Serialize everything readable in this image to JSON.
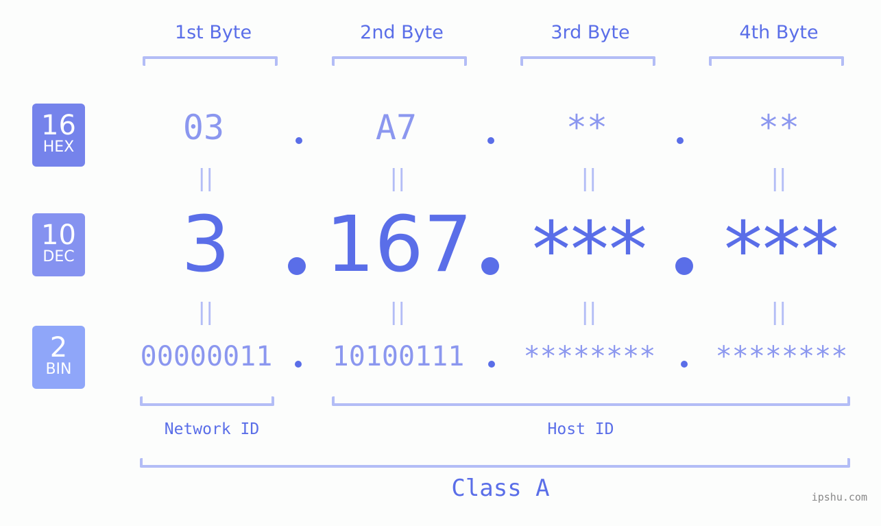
{
  "bytes": {
    "labels": [
      "1st Byte",
      "2nd Byte",
      "3rd Byte",
      "4th Byte"
    ]
  },
  "badges": {
    "hex": {
      "number": "16",
      "label": "HEX",
      "color": "#7583eb"
    },
    "dec": {
      "number": "10",
      "label": "DEC",
      "color": "#8592f0"
    },
    "bin": {
      "number": "2",
      "label": "BIN",
      "color": "#8fa6f9"
    }
  },
  "hex_values": [
    "03",
    "A7",
    "**",
    "**"
  ],
  "dec_values": [
    "3",
    "167",
    "***",
    "***"
  ],
  "bin_values": [
    "00000011",
    "10100111",
    "********",
    "********"
  ],
  "equals_symbol": "||",
  "sections": {
    "network_id": "Network ID",
    "host_id": "Host ID",
    "class": "Class A"
  },
  "footer": {
    "site": "ipshu.com"
  },
  "colors": {
    "primary": "#5a6ee8",
    "light": "#8b97ef",
    "bracket": "#b3bdf6",
    "background": "#fcfdfc"
  }
}
